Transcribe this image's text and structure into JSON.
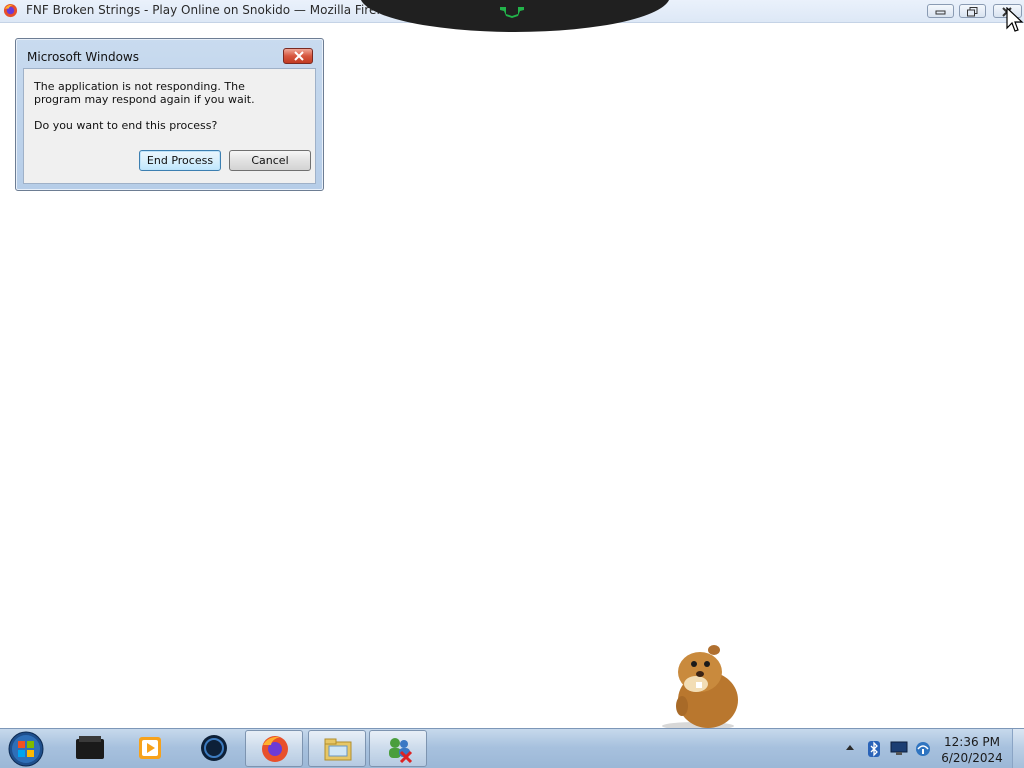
{
  "browser_window": {
    "title": "FNF Broken Strings - Play Online on Snokido — Mozilla Firefox (Not Responding)",
    "icon": "firefox-icon",
    "controls": [
      "minimize-icon",
      "restore-icon",
      "close-icon"
    ]
  },
  "dialog": {
    "caption": "Microsoft Windows",
    "message_line1": "The application is not responding. The program may respond again if you wait.",
    "message_line2": "Do you want to end this process?",
    "end_process_label": "End Process",
    "cancel_label": "Cancel",
    "close_icon": "close-icon"
  },
  "taskbar": {
    "start_icon": "windows-start-orb",
    "apps": [
      {
        "icon": "dark-app-icon",
        "active": false
      },
      {
        "icon": "media-player-icon",
        "active": false
      },
      {
        "icon": "globe-app-icon",
        "active": false
      },
      {
        "icon": "firefox-icon",
        "active": true
      },
      {
        "icon": "file-explorer-icon",
        "active": true
      },
      {
        "icon": "network-users-icon",
        "active": true
      }
    ],
    "tray_icons": [
      "show-hidden-icons",
      "bluetooth-icon",
      "display-icon",
      "network-status-icon"
    ],
    "clock_time": "12:36 PM",
    "clock_date": "6/20/2024"
  },
  "desktop": {
    "overlay_character": "gopher-mascot"
  },
  "colors": {
    "dialog_frame": "#b6cde8",
    "taskbar": "#a7c1de",
    "close_red": "#c23b22"
  }
}
